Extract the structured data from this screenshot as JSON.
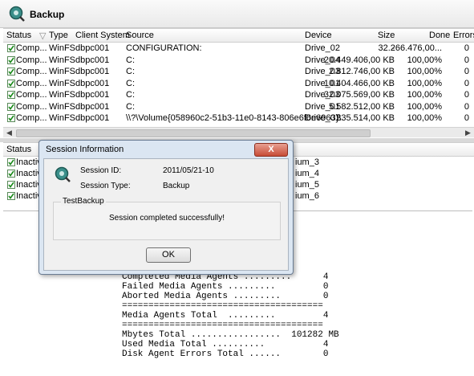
{
  "app": {
    "title": "Backup",
    "icon": "magnifier-disk-icon"
  },
  "top_table": {
    "headers": [
      "Status",
      "Type",
      "Client System",
      "Source",
      "Device",
      "Size",
      "Done",
      "Errors"
    ],
    "rows": [
      {
        "status": "Comp...",
        "type": "WinFS",
        "client": "dbpc001",
        "source": "CONFIGURATION:",
        "device": "Drive_02",
        "size": "-",
        "done": "32.266.476,00...",
        "errors": "0"
      },
      {
        "status": "Comp...",
        "type": "WinFS",
        "client": "dbpc001",
        "source": "C:",
        "device": "Drive_04",
        "size": "20.449.406,00 KB",
        "done": "100,00%",
        "errors": "0"
      },
      {
        "status": "Comp...",
        "type": "WinFS",
        "client": "dbpc001",
        "source": "C:",
        "device": "Drive_03",
        "size": "2.812.746,00 KB",
        "done": "100,00%",
        "errors": "0"
      },
      {
        "status": "Comp...",
        "type": "WinFS",
        "client": "dbpc001",
        "source": "C:",
        "device": "Drive_01",
        "size": "10.404.466,00 KB",
        "done": "100,00%",
        "errors": "0"
      },
      {
        "status": "Comp...",
        "type": "WinFS",
        "client": "dbpc001",
        "source": "C:",
        "device": "Drive_03",
        "size": "32.075.569,00 KB",
        "done": "100,00%",
        "errors": "0"
      },
      {
        "status": "Comp...",
        "type": "WinFS",
        "client": "dbpc001",
        "source": "C:",
        "device": "Drive_01",
        "size": "5.582.512,00 KB",
        "done": "100,00%",
        "errors": "0"
      },
      {
        "status": "Comp...",
        "type": "WinFS",
        "client": "dbpc001",
        "source": "\\\\?\\Volume{058960c2-51b3-11e0-8143-806e6f6e6963}\\",
        "device": "Drive_01",
        "size": "335.514,00 KB",
        "done": "100,00%",
        "errors": "0"
      }
    ]
  },
  "bottom_table": {
    "header_status": "Status",
    "rows": [
      {
        "status": "Inactiv",
        "right": "ium_3"
      },
      {
        "status": "Inactiv",
        "right": "ium_4"
      },
      {
        "status": "Inactiv",
        "right": "ium_5"
      },
      {
        "status": "Inactiv",
        "right": "ium_6"
      }
    ]
  },
  "log": {
    "lines": [
      "Completed Media Agents .........      4",
      "Failed Media Agents .........         0",
      "Aborted Media Agents .........        0",
      "======================================",
      "Media Agents Total  .........         4",
      "======================================",
      "Mbytes Total .................  101282 MB",
      "Used Media Total ..........           4",
      "Disk Agent Errors Total ......        0"
    ]
  },
  "dialog": {
    "title": "Session Information",
    "close": "X",
    "session_id_label": "Session ID:",
    "session_id_value": "2011/05/21-10",
    "session_type_label": "Session Type:",
    "session_type_value": "Backup",
    "group_title": "TestBackup",
    "message": "Session completed successfully!",
    "ok": "OK"
  }
}
